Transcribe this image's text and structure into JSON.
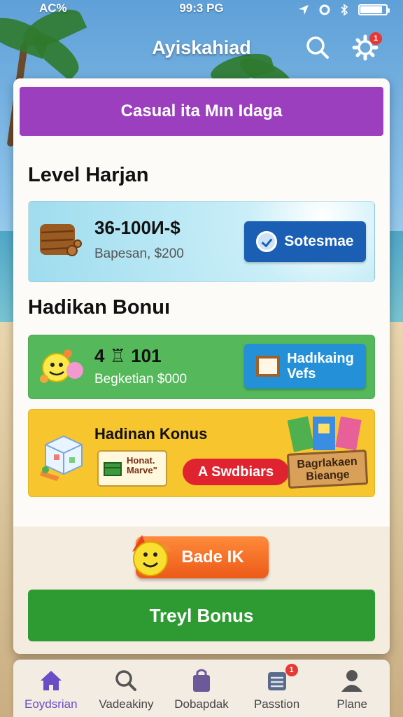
{
  "status_bar": {
    "left": "AC%",
    "time": "99:3 PG"
  },
  "header": {
    "title": "Ayiskahiad",
    "notification_count": "1"
  },
  "banner": {
    "text": "Casual ita Mın Idaga"
  },
  "sections": {
    "level_heading": "Level Harjan",
    "bonus_heading": "Hadikan Bonuı"
  },
  "level_card": {
    "amount": "36-100И-$",
    "subtitle": "Bapesan, $200",
    "button_label": "Sotesmae"
  },
  "bonus_card": {
    "amount": "4 ♖ 101",
    "subtitle": "Begketian $000",
    "button_line1": "Hadıkaing",
    "button_line2": "Vefs"
  },
  "promo_card": {
    "title": "Hadinan Konus",
    "sticker_line1": "Honat.",
    "sticker_line2": "Marve\"",
    "pill_label": "A Swdbiars",
    "sign_line1": "Bagrlakaen",
    "sign_line2": "Bieange"
  },
  "actions": {
    "bade_label": "Bade IK",
    "treyl_label": "Treyl Bonus"
  },
  "bottom_nav": {
    "items": [
      {
        "label": "Eoydsrian",
        "icon": "home-icon",
        "active": true
      },
      {
        "label": "Vadeakiny",
        "icon": "search-icon"
      },
      {
        "label": "Dobapdak",
        "icon": "bag-icon"
      },
      {
        "label": "Passtion",
        "icon": "stack-icon",
        "badge": "1"
      },
      {
        "label": "Plane",
        "icon": "profile-icon"
      }
    ]
  },
  "colors": {
    "banner": "#9b3fbf",
    "primary_button": "#1a5fb4",
    "green_card": "#55b85a",
    "yellow_card": "#f7c52e",
    "orange_button": "#ec5a18",
    "green_button": "#2d9b32",
    "nav_active": "#6a4cc4"
  }
}
